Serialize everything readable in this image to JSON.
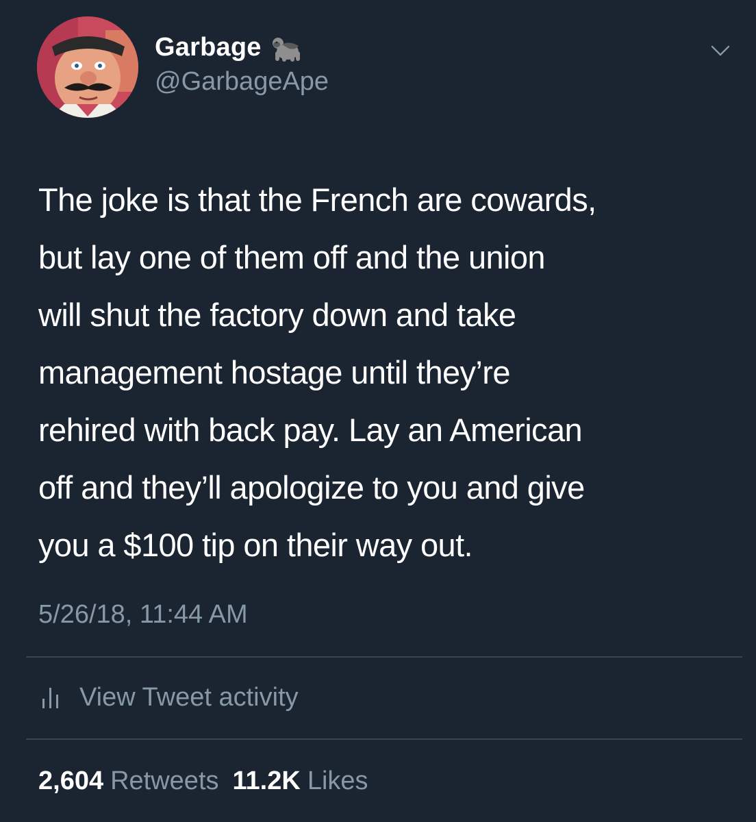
{
  "author": {
    "display_name": "Garbage",
    "name_emoji": "gorilla-emoji",
    "handle": "@GarbageApe",
    "avatar": "avatar-image"
  },
  "menu": {
    "icon": "chevron-down-icon"
  },
  "tweet": {
    "lines": [
      "The joke is that the French are cowards,",
      "but lay one of them off and the union",
      "will shut the factory down and take",
      "management hostage until they’re",
      "rehired with back pay. Lay an American",
      "off and they’ll apologize to you and give",
      "you a $100 tip on their way out."
    ],
    "timestamp": "5/26/18, 11:44 AM"
  },
  "activity": {
    "icon": "bar-chart-icon",
    "label": "View Tweet activity"
  },
  "stats": {
    "retweets_count": "2,604",
    "retweets_label": "Retweets",
    "likes_count": "11.2K",
    "likes_label": "Likes"
  },
  "colors": {
    "background": "#1b2431",
    "primary_text": "#ffffff",
    "secondary_text": "#8899a6",
    "divider": "#38444d"
  }
}
